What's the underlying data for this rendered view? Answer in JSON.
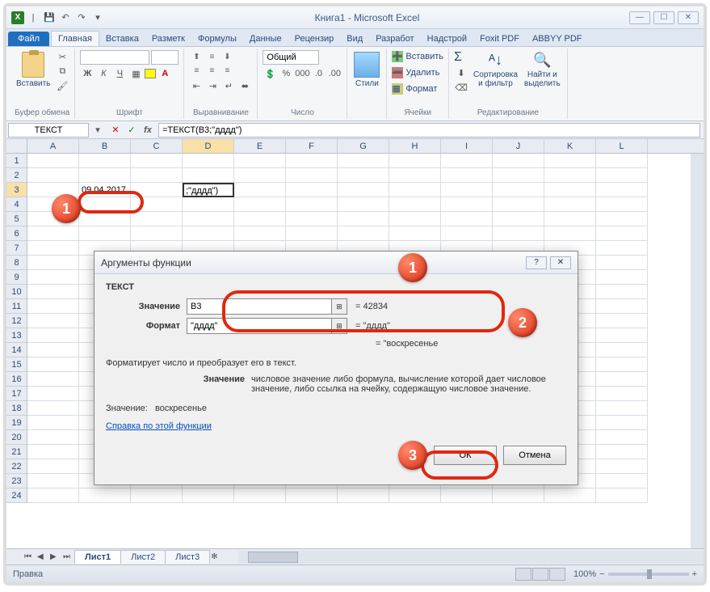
{
  "title": "Книга1  -  Microsoft Excel",
  "tabs": {
    "file": "Файл",
    "list": [
      "Главная",
      "Вставка",
      "Разметк",
      "Формулы",
      "Данные",
      "Рецензир",
      "Вид",
      "Разработ",
      "Надстрой",
      "Foxit PDF",
      "ABBYY PDF"
    ],
    "active": 0
  },
  "ribbon": {
    "clipboard": {
      "paste": "Вставить",
      "group": "Буфер обмена"
    },
    "font": {
      "group": "Шрифт"
    },
    "align": {
      "group": "Выравнивание"
    },
    "number": {
      "format": "Общий",
      "group": "Число"
    },
    "styles": {
      "btn": "Стили"
    },
    "cells": {
      "insert": "Вставить",
      "delete": "Удалить",
      "format": "Формат",
      "group": "Ячейки"
    },
    "editing": {
      "sort": "Сортировка\nи фильтр",
      "find": "Найти и\nвыделить",
      "group": "Редактирование"
    }
  },
  "fbar": {
    "name": "ТЕКСТ",
    "formula": "=ТЕКСТ(B3;\"дддд\")"
  },
  "columns": [
    "A",
    "B",
    "C",
    "D",
    "E",
    "F",
    "G",
    "H",
    "I",
    "J",
    "K",
    "L"
  ],
  "rows_count": 24,
  "sheet": {
    "b3": "09.04.2017",
    "d3": ";\"дддд\")"
  },
  "dialog": {
    "title": "Аргументы функции",
    "func": "ТЕКСТ",
    "arg1_label": "Значение",
    "arg1_value": "B3",
    "arg1_result": "=  42834",
    "arg2_label": "Формат",
    "arg2_value": "\"дддд\"",
    "arg2_result": "=  \"дддд\"",
    "preview": "=  \"воскресенье",
    "desc": "Форматирует число и преобразует его в текст.",
    "desc_label": "Значение",
    "desc_text": "числовое значение либо формула, вычисление которой дает числовое значение, либо ссылка на ячейку, содержащую числовое значение.",
    "result_label": "Значение:",
    "result_value": "воскресенье",
    "help": "Справка по этой функции",
    "ok": "ОК",
    "cancel": "Отмена"
  },
  "sheets": [
    "Лист1",
    "Лист2",
    "Лист3"
  ],
  "status": {
    "mode": "Правка",
    "zoom": "100%"
  },
  "markers": {
    "m1": "1",
    "m2": "1",
    "m3": "2",
    "m4": "3"
  }
}
